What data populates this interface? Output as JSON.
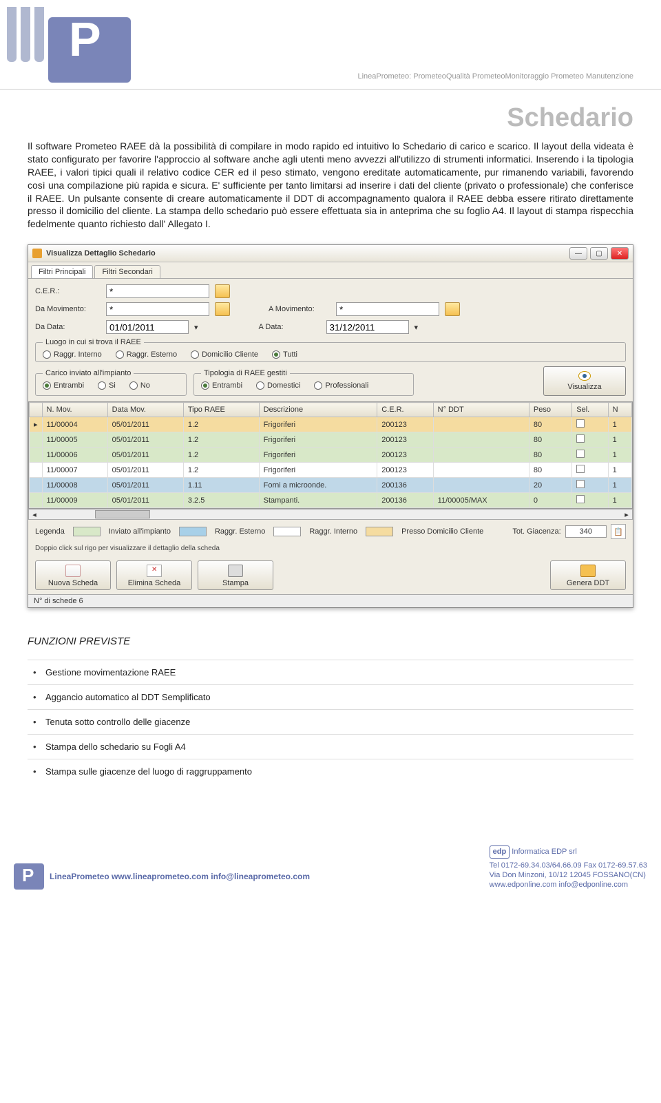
{
  "header": {
    "tagline_html": "LineaPrometeo: PrometeoQualità PrometeoMonitoraggio Prometeo Manutenzione"
  },
  "page": {
    "title": "Schedario",
    "body": "Il software Prometeo RAEE dà la possibilità di compilare in modo rapido ed intuitivo lo Schedario di carico e scarico. Il layout della videata è stato configurato per favorire l'approccio al software anche agli utenti meno avvezzi all'utilizzo di strumenti informatici. Inserendo i la tipologia RAEE, i valori tipici quali il relativo codice CER ed il peso stimato, vengono ereditate automaticamente, pur rimanendo variabili, favorendo così una compilazione più rapida e sicura. E' sufficiente per tanto limitarsi ad inserire i dati del cliente (privato o professionale) che conferisce il RAEE. Un pulsante consente di creare automaticamente il DDT di accompagnamento qualora il RAEE debba essere ritirato direttamente presso il domicilio del cliente. La stampa dello schedario può essere effettuata sia in anteprima che su foglio A4. Il layout di stampa rispecchia fedelmente quanto richiesto dall' Allegato I."
  },
  "window": {
    "title": "Visualizza Dettaglio Schedario",
    "tabs": [
      "Filtri Principali",
      "Filtri Secondari"
    ],
    "filters": {
      "cer_label": "C.E.R.:",
      "cer_value": "*",
      "da_mov_label": "Da Movimento:",
      "da_mov_value": "*",
      "a_mov_label": "A Movimento:",
      "a_mov_value": "*",
      "da_data_label": "Da Data:",
      "da_data_value": "01/01/2011",
      "a_data_label": "A Data:",
      "a_data_value": "31/12/2011"
    },
    "luogo": {
      "legend": "Luogo in cui si trova il RAEE",
      "options": [
        "Raggr. Interno",
        "Raggr. Esterno",
        "Domicilio Cliente",
        "Tutti"
      ],
      "selected": 3
    },
    "carico": {
      "legend": "Carico inviato all'impianto",
      "options": [
        "Entrambi",
        "Si",
        "No"
      ],
      "selected": 0
    },
    "tipologia": {
      "legend": "Tipologia di RAEE gestiti",
      "options": [
        "Entrambi",
        "Domestici",
        "Professionali"
      ],
      "selected": 0
    },
    "visualizza": "Visualizza",
    "columns": [
      "",
      "N. Mov.",
      "Data Mov.",
      "Tipo RAEE",
      "Descrizione",
      "C.E.R.",
      "N° DDT",
      "Peso",
      "Sel.",
      "N"
    ],
    "rows": [
      {
        "cls": "r-orange",
        "mov": "11/00004",
        "data": "05/01/2011",
        "tipo": "1.2",
        "desc": "Frigoriferi",
        "cer": "200123",
        "ddt": "",
        "peso": "80",
        "n": "1"
      },
      {
        "cls": "r-green",
        "mov": "11/00005",
        "data": "05/01/2011",
        "tipo": "1.2",
        "desc": "Frigoriferi",
        "cer": "200123",
        "ddt": "",
        "peso": "80",
        "n": "1"
      },
      {
        "cls": "r-green",
        "mov": "11/00006",
        "data": "05/01/2011",
        "tipo": "1.2",
        "desc": "Frigoriferi",
        "cer": "200123",
        "ddt": "",
        "peso": "80",
        "n": "1"
      },
      {
        "cls": "",
        "mov": "11/00007",
        "data": "05/01/2011",
        "tipo": "1.2",
        "desc": "Frigoriferi",
        "cer": "200123",
        "ddt": "",
        "peso": "80",
        "n": "1"
      },
      {
        "cls": "r-blue",
        "mov": "11/00008",
        "data": "05/01/2011",
        "tipo": "1.11",
        "desc": "Forni a microonde.",
        "cer": "200136",
        "ddt": "",
        "peso": "20",
        "n": "1"
      },
      {
        "cls": "r-green",
        "mov": "11/00009",
        "data": "05/01/2011",
        "tipo": "3.2.5",
        "desc": "Stampanti.",
        "cer": "200136",
        "ddt": "11/00005/MAX",
        "peso": "0",
        "n": "1"
      }
    ],
    "legend": {
      "label": "Legenda",
      "items": [
        "Inviato all'impianto",
        "Raggr. Esterno",
        "Raggr. Interno",
        "Presso Domicilio Cliente"
      ]
    },
    "tot": {
      "label": "Tot. Giacenza:",
      "value": "340"
    },
    "hint": "Doppio click sul rigo per visualizzare il dettaglio della scheda",
    "buttons": {
      "nuova": "Nuova Scheda",
      "elimina": "Elimina Scheda",
      "stampa": "Stampa",
      "genera": "Genera DDT"
    },
    "status": "N° di schede 6"
  },
  "funzioni": {
    "heading": "FUNZIONI PREVISTE",
    "items": [
      "Gestione movimentazione RAEE",
      "Aggancio automatico al DDT Semplificato",
      "Tenuta sotto controllo delle giacenze",
      "Stampa dello schedario su Fogli A4",
      "Stampa sulle giacenze del luogo di raggruppamento"
    ]
  },
  "footer": {
    "left": "LineaPrometeo www.lineaprometeo.com  info@lineaprometeo.com",
    "right": {
      "brand": "edp",
      "name": "Informatica EDP srl",
      "tel": "Tel 0172-69.34.03/64.66.09  Fax 0172-69.57.63",
      "addr": "Via Don Minzoni, 10/12  12045 FOSSANO(CN)",
      "web": "www.edponline.com  info@edponline.com"
    }
  }
}
